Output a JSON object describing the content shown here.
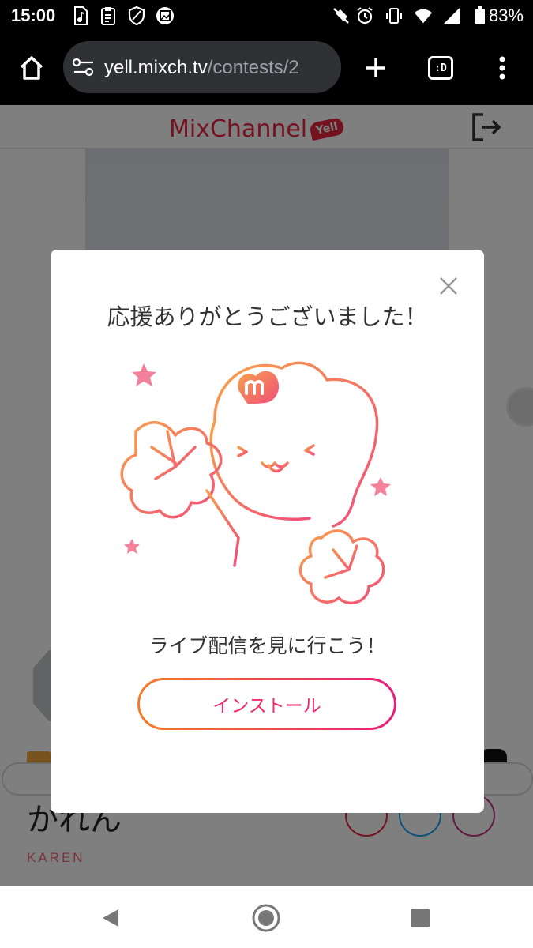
{
  "status_bar": {
    "time": "15:00",
    "battery": "83%",
    "icons": [
      "music-file-icon",
      "clipboard-icon",
      "shield-icon",
      "gallery-icon",
      "mute-icon",
      "alarm-icon",
      "vibrate-icon",
      "wifi-icon",
      "signal-icon",
      "battery-icon"
    ]
  },
  "browser": {
    "url_host": "yell.mixch.tv",
    "url_path": "/contests/2",
    "tab_switcher_label": ":D",
    "icons": [
      "home-icon",
      "site-settings-icon",
      "new-tab-icon",
      "tab-switcher-icon",
      "overflow-menu-icon"
    ]
  },
  "site": {
    "logo_text": "MixChannel",
    "logo_badge": "Yell",
    "brand_color": "#e8243f"
  },
  "artist": {
    "name": "かれん",
    "roman": "KAREN"
  },
  "modal": {
    "title": "応援ありがとうございました！",
    "subtitle": "ライブ配信を見に行こう！",
    "install_label": "インストール",
    "accent_gradient": [
      "#f57c24",
      "#ea1c7c"
    ]
  },
  "nav": {
    "icons": [
      "back-icon",
      "home-circle-icon",
      "recents-icon"
    ]
  }
}
